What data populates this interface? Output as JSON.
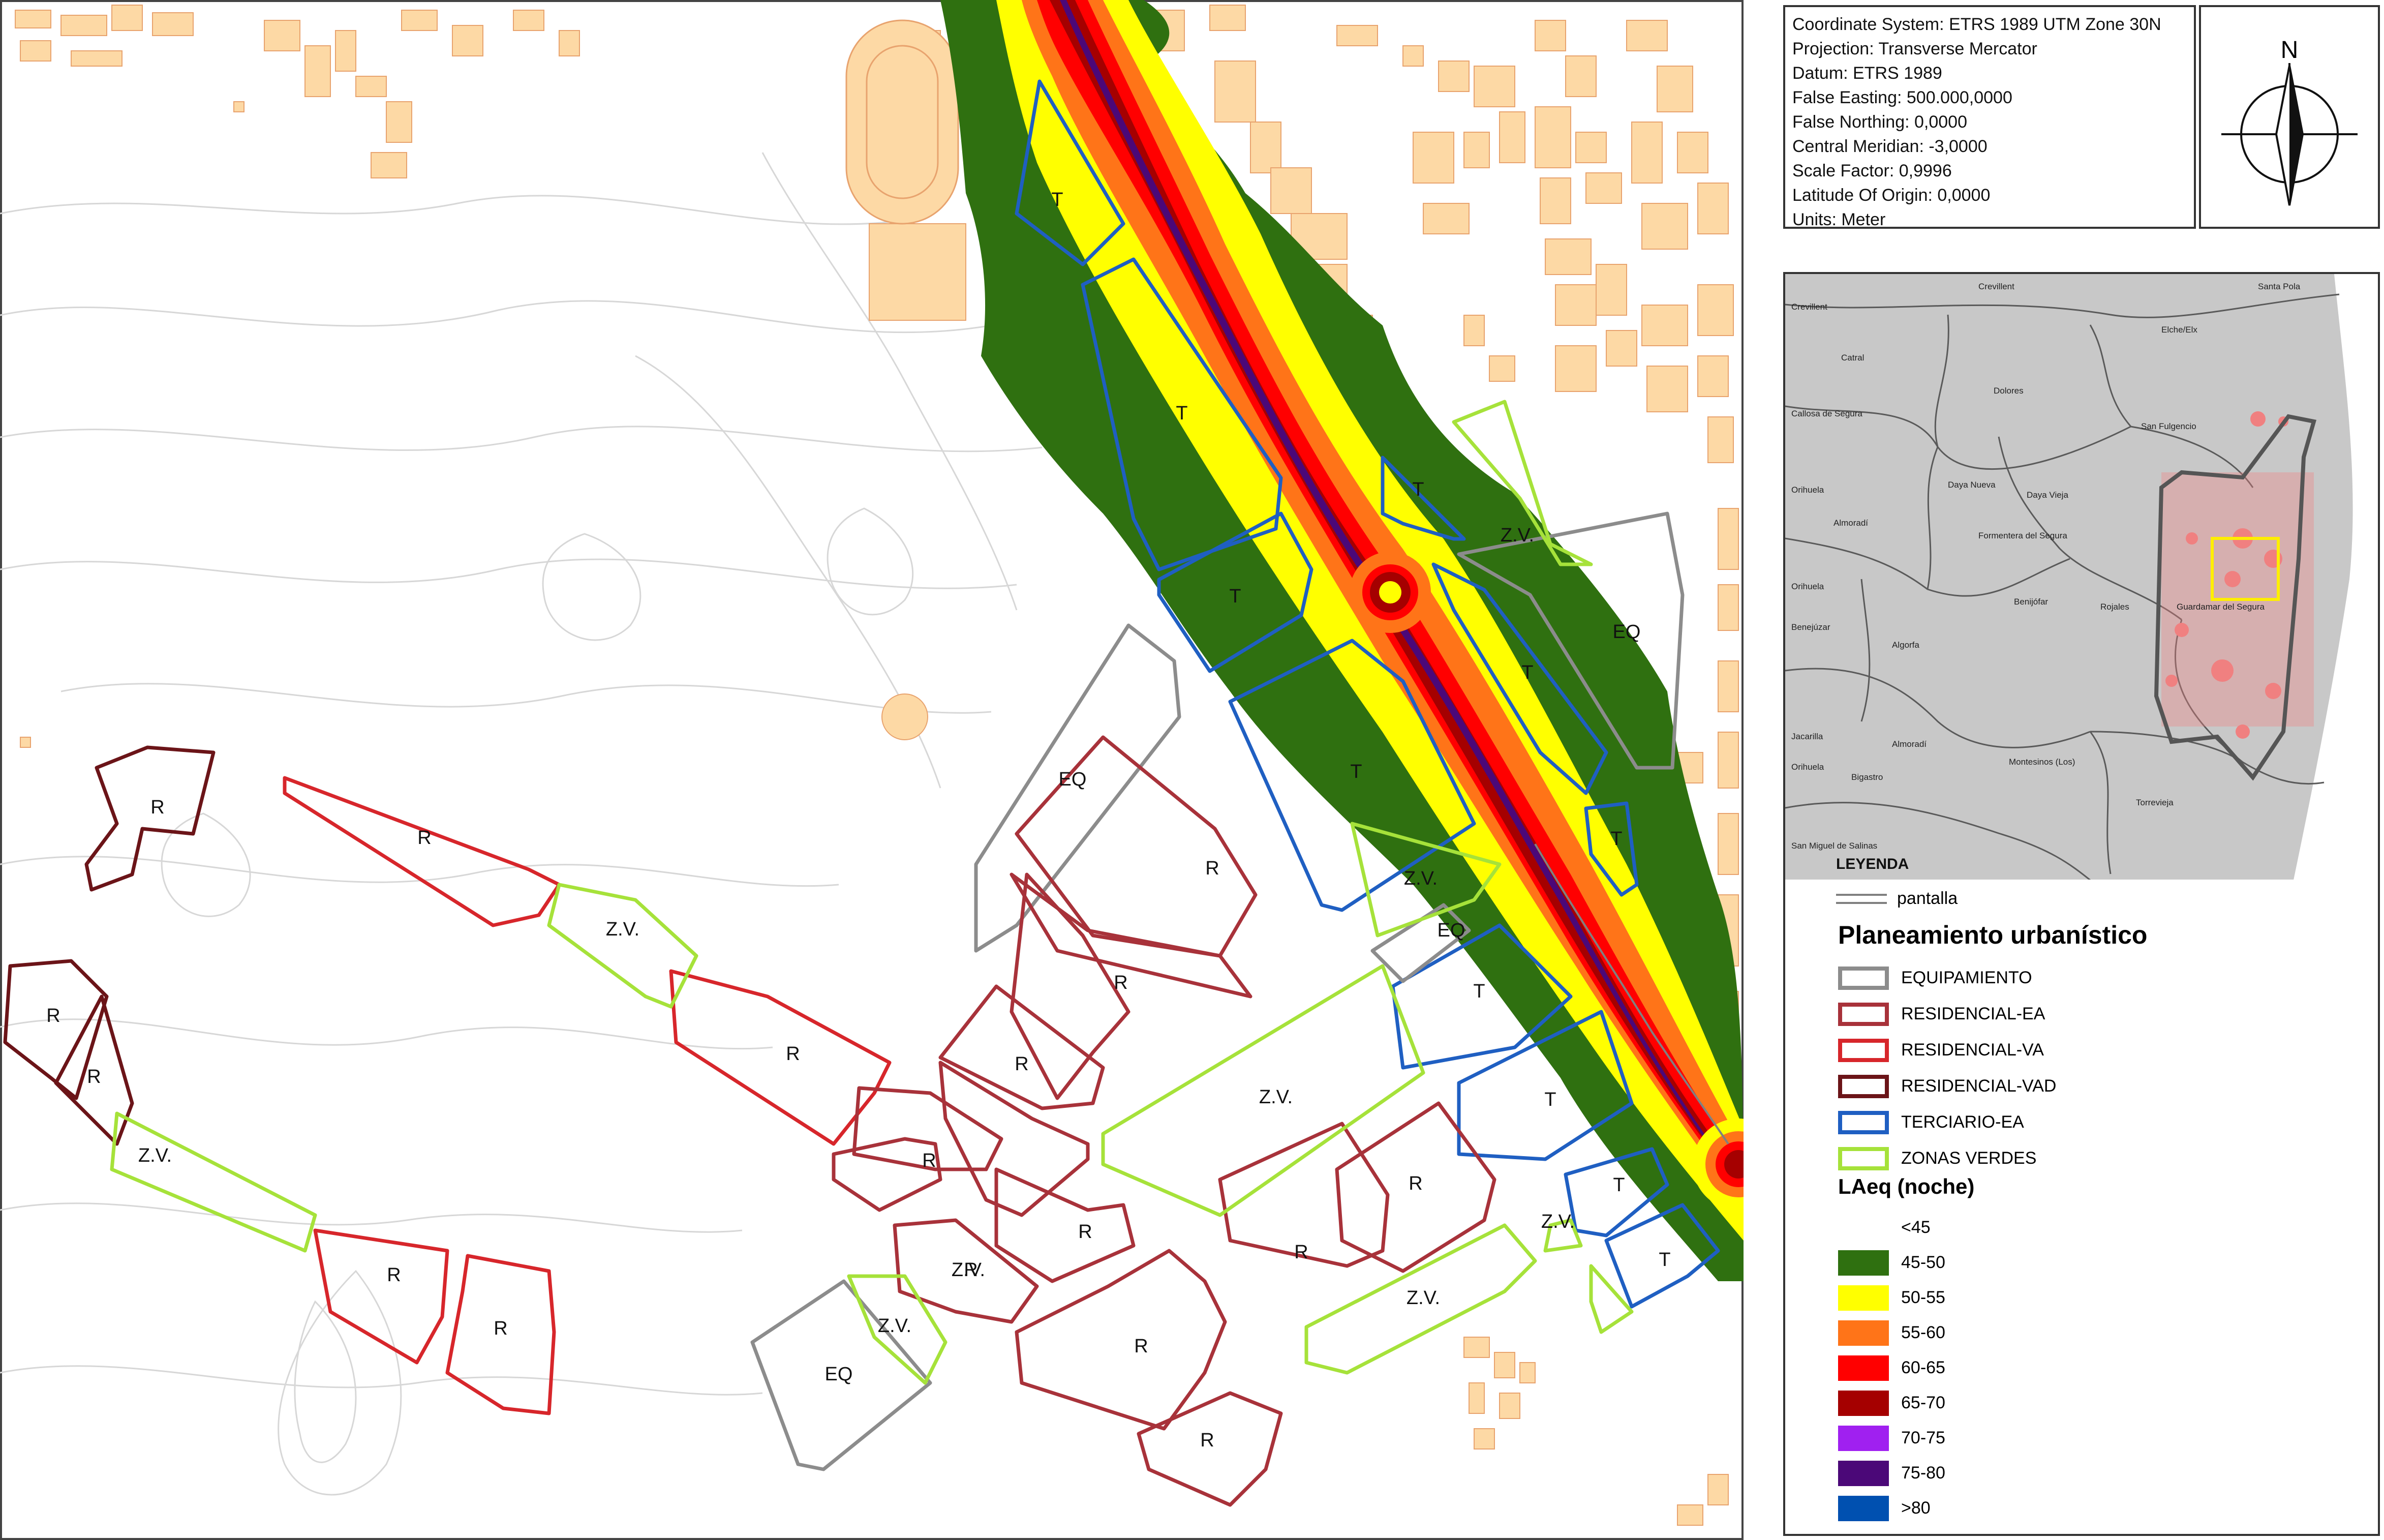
{
  "map": {
    "zones": [
      {
        "label": "T",
        "cat": "terciario"
      },
      {
        "label": "T",
        "cat": "terciario"
      },
      {
        "label": "T",
        "cat": "terciario"
      },
      {
        "label": "T",
        "cat": "terciario"
      },
      {
        "label": "T",
        "cat": "terciario"
      },
      {
        "label": "T",
        "cat": "terciario"
      },
      {
        "label": "T",
        "cat": "terciario"
      },
      {
        "label": "T",
        "cat": "terciario"
      },
      {
        "label": "T",
        "cat": "terciario"
      },
      {
        "label": "T",
        "cat": "terciario"
      },
      {
        "label": "T",
        "cat": "terciario"
      },
      {
        "label": "EQ",
        "cat": "equipamiento"
      },
      {
        "label": "EQ",
        "cat": "equipamiento"
      },
      {
        "label": "EQ",
        "cat": "equipamiento"
      },
      {
        "label": "EQ",
        "cat": "equipamiento"
      },
      {
        "label": "R",
        "cat": "res_vad"
      },
      {
        "label": "R",
        "cat": "res_va"
      },
      {
        "label": "R",
        "cat": "res_vad"
      },
      {
        "label": "R",
        "cat": "res_vad"
      },
      {
        "label": "R",
        "cat": "res_va"
      },
      {
        "label": "R",
        "cat": "res_va"
      },
      {
        "label": "R",
        "cat": "res_va"
      },
      {
        "label": "R",
        "cat": "res_va"
      },
      {
        "label": "R",
        "cat": "res_ea"
      },
      {
        "label": "R",
        "cat": "res_ea"
      },
      {
        "label": "R",
        "cat": "res_ea"
      },
      {
        "label": "R",
        "cat": "res_ea"
      },
      {
        "label": "R",
        "cat": "res_ea"
      },
      {
        "label": "R",
        "cat": "res_ea"
      },
      {
        "label": "R",
        "cat": "res_ea"
      },
      {
        "label": "R",
        "cat": "res_ea"
      },
      {
        "label": "R",
        "cat": "res_ea"
      },
      {
        "label": "Z.V.",
        "cat": "zonas_verdes"
      },
      {
        "label": "Z.V.",
        "cat": "zonas_verdes"
      },
      {
        "label": "Z.V.",
        "cat": "zonas_verdes"
      },
      {
        "label": "Z.V.",
        "cat": "zonas_verdes"
      },
      {
        "label": "Z.V.",
        "cat": "zonas_verdes"
      },
      {
        "label": "Z.V.",
        "cat": "zonas_verdes"
      },
      {
        "label": "Z.V.",
        "cat": "zonas_verdes"
      },
      {
        "label": "Z.V.",
        "cat": "zonas_verdes"
      },
      {
        "label": "Z.V.",
        "cat": "zonas_verdes"
      }
    ]
  },
  "coord": {
    "lines": [
      "Coordinate System: ETRS 1989 UTM Zone 30N",
      "Projection: Transverse Mercator",
      "Datum: ETRS 1989",
      "False Easting: 500.000,0000",
      "False Northing: 0,0000",
      "Central Meridian: -3,0000",
      "Scale Factor: 0,9996",
      "Latitude Of Origin: 0,0000",
      "Units: Meter"
    ]
  },
  "north": {
    "label": "N"
  },
  "inset": {
    "places": [
      "Crevillent",
      "Crevillent",
      "Santa Pola",
      "Elche/Elx",
      "Catral",
      "Dolores",
      "Callosa de Segura",
      "San Fulgencio",
      "Daya Nueva",
      "Daya Vieja",
      "Orihuela",
      "Almoradí",
      "Formentera del Segura",
      "Orihuela",
      "Benejúzar",
      "Benijófar",
      "Rojales",
      "Guardamar del Segura",
      "Algorfa",
      "Jacarilla",
      "Almoradí",
      "Bigastro",
      "Orihuela",
      "Montesinos (Los)",
      "Torrevieja",
      "San Miguel de Salinas"
    ]
  },
  "legend": {
    "title": "LEYENDA",
    "pantalla": "pantalla",
    "planning_title": "Planeamiento urbanístico",
    "planning": [
      {
        "label": "EQUIPAMIENTO",
        "color": "#8c8c8c"
      },
      {
        "label": "RESIDENCIAL-EA",
        "color": "#a8323a"
      },
      {
        "label": "RESIDENCIAL-VA",
        "color": "#d7262b"
      },
      {
        "label": "RESIDENCIAL-VAD",
        "color": "#6b1418"
      },
      {
        "label": "TERCIARIO-EA",
        "color": "#1f5fc2"
      },
      {
        "label": "ZONAS VERDES",
        "color": "#a6e23a"
      }
    ],
    "noise_title": "LAeq (noche)",
    "noise": [
      {
        "label": "<45",
        "color": ""
      },
      {
        "label": "45-50",
        "color": "#2f7010"
      },
      {
        "label": "50-55",
        "color": "#ffff00"
      },
      {
        "label": "55-60",
        "color": "#ff7418"
      },
      {
        "label": "60-65",
        "color": "#ff0000"
      },
      {
        "label": "65-70",
        "color": "#a50000"
      },
      {
        "label": "70-75",
        "color": "#a020f0"
      },
      {
        "label": "75-80",
        "color": "#4b0878"
      },
      {
        "label": ">80",
        "color": "#0050b0"
      }
    ]
  }
}
